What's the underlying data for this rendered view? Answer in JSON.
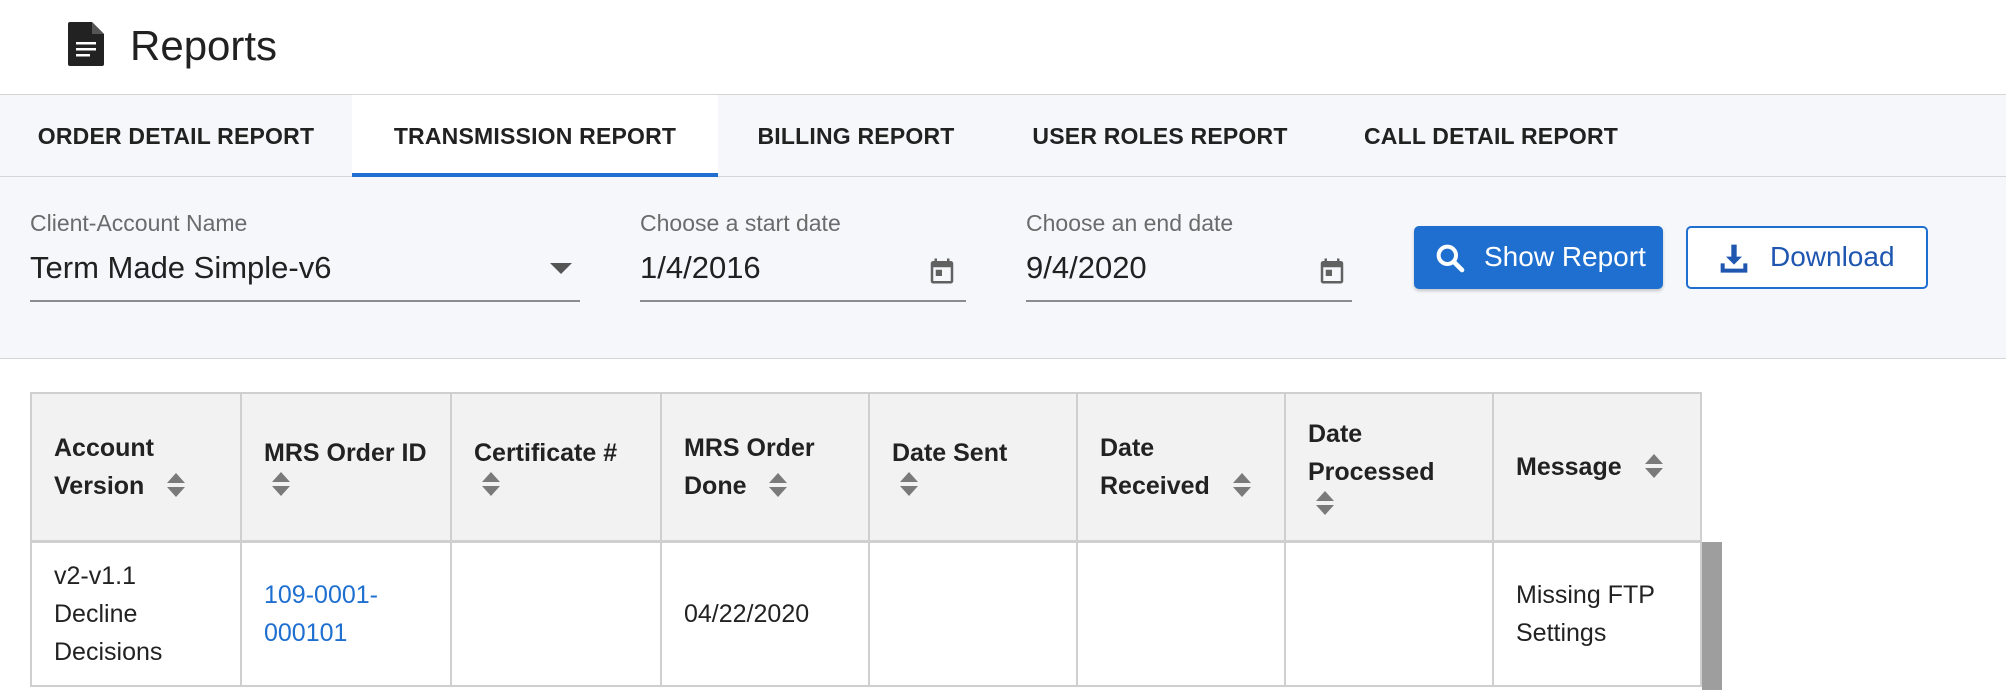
{
  "header": {
    "title": "Reports",
    "icon": "document-icon"
  },
  "tabs": [
    {
      "label": "ORDER DETAIL REPORT",
      "active": false
    },
    {
      "label": "TRANSMISSION REPORT",
      "active": true
    },
    {
      "label": "BILLING REPORT",
      "active": false
    },
    {
      "label": "USER ROLES REPORT",
      "active": false
    },
    {
      "label": "CALL DETAIL REPORT",
      "active": false
    }
  ],
  "filters": {
    "client_account": {
      "label": "Client-Account Name",
      "value": "Term Made Simple-v6"
    },
    "start_date": {
      "label": "Choose a start date",
      "value": "1/4/2016"
    },
    "end_date": {
      "label": "Choose an end date",
      "value": "9/4/2020"
    },
    "show_report_label": "Show Report",
    "download_label": "Download"
  },
  "table": {
    "columns": [
      {
        "l1": "Account",
        "l2": "Version"
      },
      {
        "l1": "MRS Order ID",
        "l2": ""
      },
      {
        "l1": "Certificate #",
        "l2": ""
      },
      {
        "l1": "MRS Order",
        "l2": "Done"
      },
      {
        "l1": "Date Sent",
        "l2": ""
      },
      {
        "l1": "Date",
        "l2": "Received"
      },
      {
        "l1": "Date",
        "l2": "Processed"
      },
      {
        "l1": "Message",
        "l2": ""
      }
    ],
    "rows": [
      {
        "account_version": [
          "v2-v1.1",
          "Decline",
          "Decisions"
        ],
        "mrs_order_id": [
          "109-0001-",
          "000101"
        ],
        "certificate": "",
        "mrs_order_done": "04/22/2020",
        "date_sent": "",
        "date_received": "",
        "date_processed": "",
        "message": [
          "Missing FTP",
          "Settings"
        ]
      }
    ]
  },
  "colors": {
    "accent": "#1e6fd0",
    "header_bg": "#f2f2f2",
    "panel_bg": "#f5f7fa",
    "link": "#1e6fd0"
  }
}
